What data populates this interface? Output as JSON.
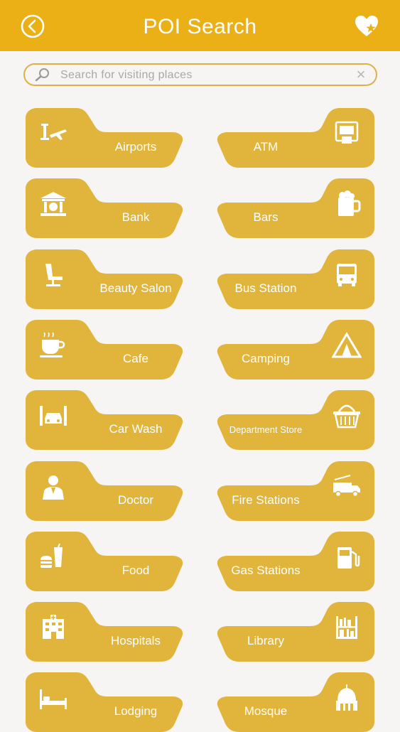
{
  "header": {
    "title": "POI Search"
  },
  "search": {
    "placeholder": "Search for visiting places",
    "clear_symbol": "×"
  },
  "colors": {
    "header_bg": "#ebb016",
    "tile_bg": "#e1b43c",
    "search_border": "#ddb145"
  },
  "categories": [
    {
      "label": "Airports",
      "icon": "airport-icon"
    },
    {
      "label": "ATM",
      "icon": "atm-icon"
    },
    {
      "label": "Bank",
      "icon": "bank-icon"
    },
    {
      "label": "Bars",
      "icon": "beer-mug-icon"
    },
    {
      "label": "Beauty Salon",
      "icon": "salon-chair-icon"
    },
    {
      "label": "Bus Station",
      "icon": "bus-icon"
    },
    {
      "label": "Cafe",
      "icon": "coffee-cup-icon"
    },
    {
      "label": "Camping",
      "icon": "tent-icon"
    },
    {
      "label": "Car Wash",
      "icon": "car-wash-icon"
    },
    {
      "label": "Department Store",
      "icon": "shopping-basket-icon"
    },
    {
      "label": "Doctor",
      "icon": "doctor-icon"
    },
    {
      "label": "Fire Stations",
      "icon": "fire-truck-icon"
    },
    {
      "label": "Food",
      "icon": "fast-food-icon"
    },
    {
      "label": "Gas Stations",
      "icon": "fuel-pump-icon"
    },
    {
      "label": "Hospitals",
      "icon": "hospital-building-icon"
    },
    {
      "label": "Library",
      "icon": "bookshelf-icon"
    },
    {
      "label": "Lodging",
      "icon": "bed-icon"
    },
    {
      "label": "Mosque",
      "icon": "mosque-icon"
    }
  ]
}
